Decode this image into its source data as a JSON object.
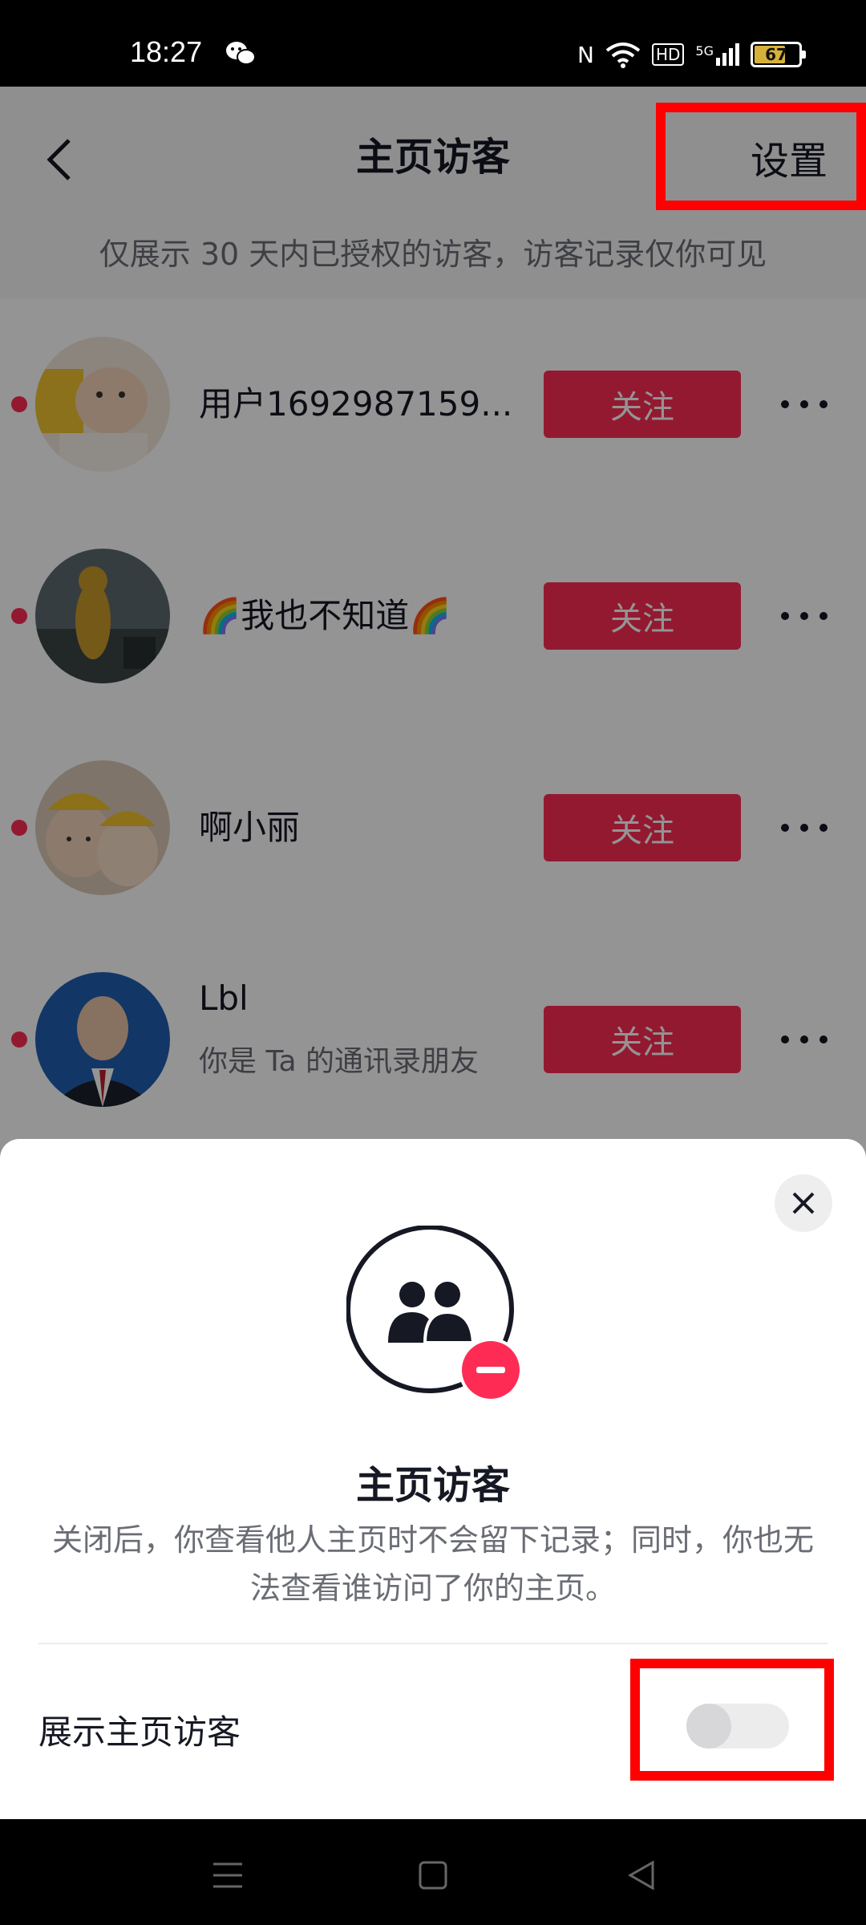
{
  "status_bar": {
    "time": "18:27",
    "battery": "67",
    "icons": [
      "wechat-icon",
      "nfc-icon",
      "wifi-icon",
      "hd-icon",
      "5g-signal-icon",
      "battery-icon"
    ],
    "nfc_glyph": "N",
    "hd_glyph": "HD",
    "network_glyph": "5G"
  },
  "header": {
    "title": "主页访客",
    "settings_label": "设置",
    "subtitle": "仅展示 30 天内已授权的访客，访客记录仅你可见"
  },
  "visitors": [
    {
      "name": "用户1692987159...",
      "follow_label": "关注",
      "unread": true
    },
    {
      "name": "🌈我也不知道🌈",
      "follow_label": "关注",
      "unread": true
    },
    {
      "name": "啊小丽",
      "follow_label": "关注",
      "unread": true
    },
    {
      "name": "Lbl",
      "sub": "你是 Ta 的通讯录朋友",
      "follow_label": "关注",
      "unread": true
    }
  ],
  "sheet": {
    "title": "主页访客",
    "description": "关闭后，你查看他人主页时不会留下记录；同时，你也无法查看谁访问了你的主页。",
    "toggle_label": "展示主页访客",
    "toggle_on": false
  },
  "colors": {
    "accent": "#fe2c55",
    "highlight": "#ff0000"
  }
}
